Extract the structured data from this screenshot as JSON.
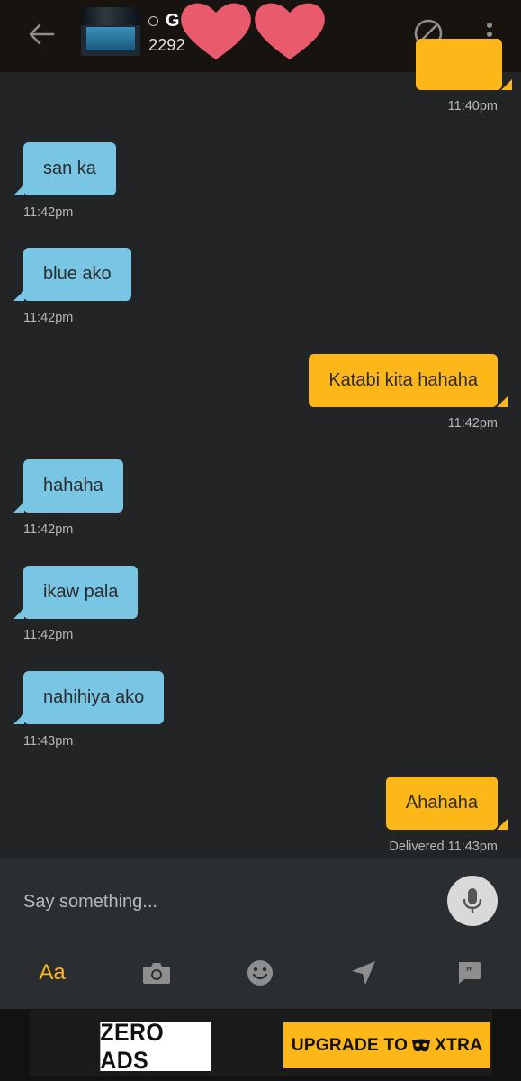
{
  "header": {
    "profile_name": "G",
    "profile_distance": "2292",
    "avatar_alt": "profile-photo"
  },
  "messages": [
    {
      "direction": "out",
      "text": "",
      "time": "11:40pm"
    },
    {
      "direction": "in",
      "text": "san ka",
      "time": "11:42pm"
    },
    {
      "direction": "in",
      "text": "blue ako",
      "time": "11:42pm"
    },
    {
      "direction": "out",
      "text": "Katabi kita hahaha",
      "time": "11:42pm"
    },
    {
      "direction": "in",
      "text": "hahaha",
      "time": "11:42pm"
    },
    {
      "direction": "in",
      "text": "ikaw pala",
      "time": "11:42pm"
    },
    {
      "direction": "in",
      "text": "nahihiya ako",
      "time": "11:43pm"
    },
    {
      "direction": "out",
      "text": "Ahahaha",
      "time": "Delivered  11:43pm"
    }
  ],
  "composer": {
    "placeholder": "Say something..."
  },
  "toolbar": {
    "text_label": "Aa",
    "icons": [
      "camera-icon",
      "emoji-icon",
      "location-icon",
      "saved-phrases-icon"
    ]
  },
  "ad": {
    "zero_ads": "ZERO ADS",
    "upgrade_prefix": "UPGRADE TO",
    "upgrade_suffix": "XTRA"
  },
  "colors": {
    "incoming": "#79c5e4",
    "outgoing": "#fdb718",
    "background": "#222426"
  }
}
